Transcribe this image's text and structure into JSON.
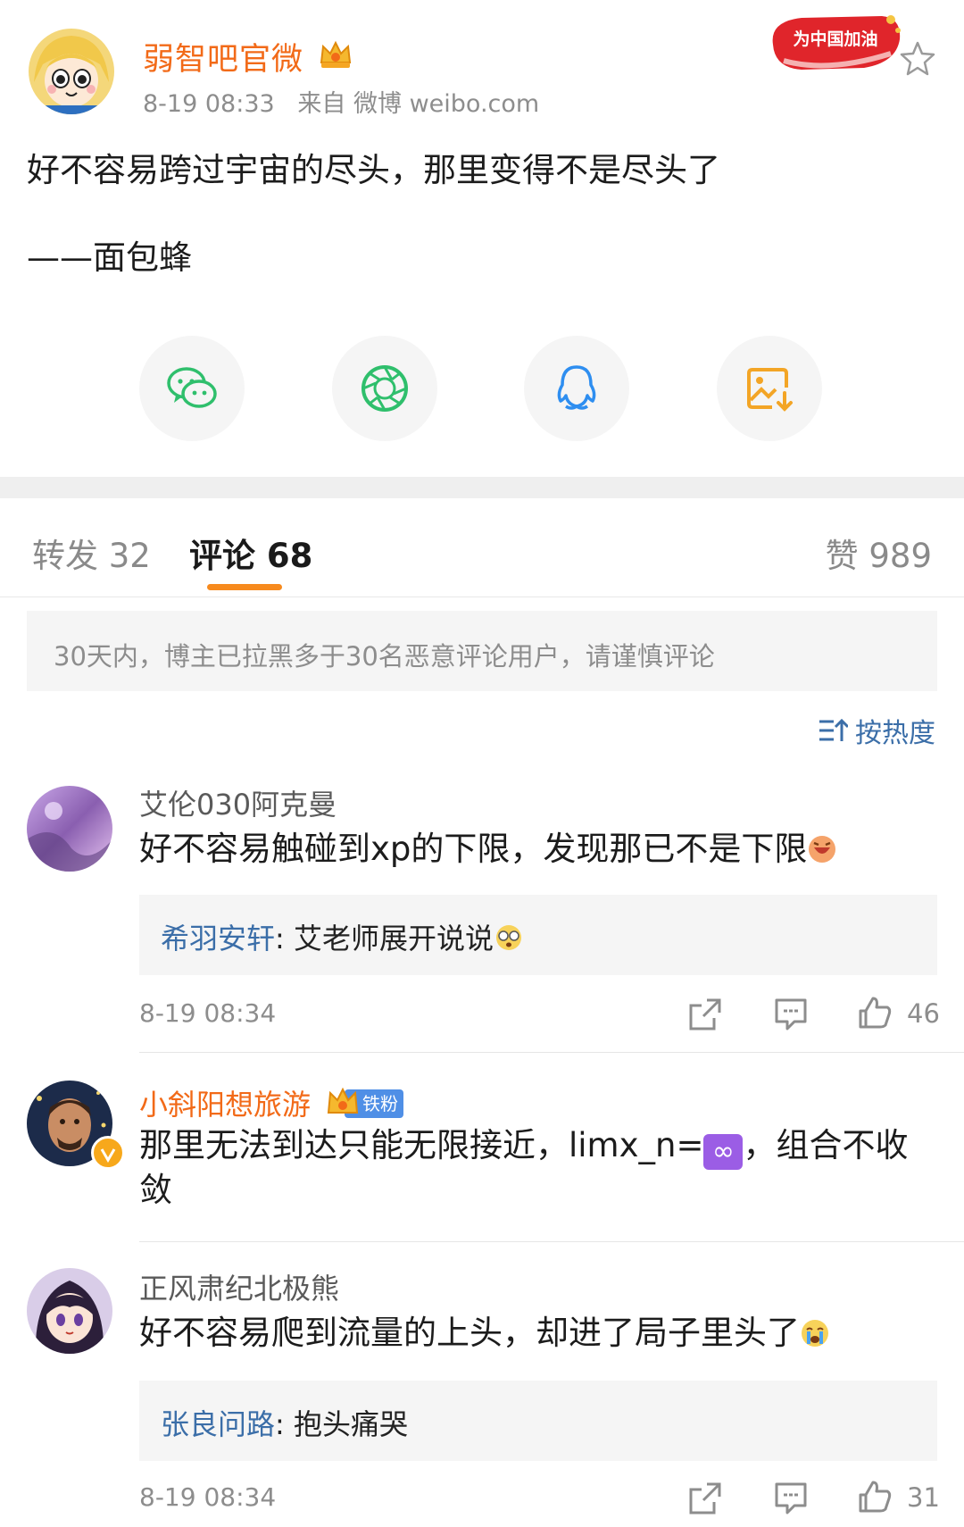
{
  "post": {
    "author": "弱智吧官微",
    "time": "8-19 08:33",
    "source": "来自 微博 weibo.com",
    "campaign_badge": "为中国加油",
    "text_line1": "好不容易跨过宇宙的尽头，那里变得不是尽头了",
    "text_line2": "——面包蜂",
    "share_buttons": [
      "wechat-icon",
      "moments-icon",
      "qq-icon",
      "save-image-icon"
    ]
  },
  "tabs": {
    "repost": "转发 32",
    "comments": "评论 68",
    "likes": "赞 989"
  },
  "notice": "30天内，博主已拉黑多于30名恶意评论用户，请谨慎评论",
  "sort_label": "按热度",
  "comments": [
    {
      "name": "艾伦030阿克曼",
      "text": "好不容易触碰到xp的下限，发现那已不是下限",
      "reply_user": "希羽安轩",
      "reply_text": ": 艾老师展开说说",
      "time": "8-19 08:34",
      "likes": "46"
    },
    {
      "name": "小斜阳想旅游",
      "badge": "铁粉",
      "text_a": "那里无法到达只能无限接近，limx_n=",
      "inf_symbol": "∞",
      "text_b": "，组合不收",
      "text_line2": "敛"
    },
    {
      "name": "正风肃纪北极熊",
      "text": "好不容易爬到流量的上头，却进了局子里头了",
      "reply_user": "张良问路",
      "reply_text": ": 抱头痛哭",
      "time": "8-19 08:34",
      "likes": "31"
    }
  ],
  "colors": {
    "accent_orange": "#f26a18",
    "tab_underline": "#f78a1d",
    "link_blue": "#3b6ea8",
    "gray_text": "#8d8d8d"
  }
}
